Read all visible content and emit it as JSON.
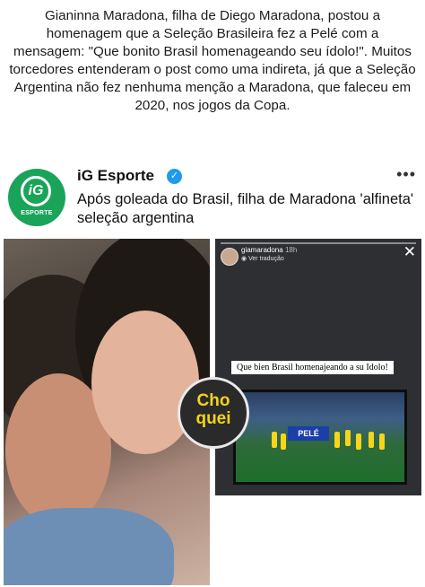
{
  "caption": "Gianinna Maradona, filha de Diego Maradona, postou a homenagem que a Seleção Brasileira fez a Pelé com a mensagem: \"Que bonito Brasil homenageando seu ídolo!\". Muitos torcedores entenderam o post como uma indireta, já que a Seleção Argentina não fez nenhuma menção a Maradona, que faleceu em 2020, nos jogos da Copa.",
  "post": {
    "account_name": "iG Esporte",
    "avatar_brand": "ESPORTE",
    "avatar_mark": "iG",
    "verified_glyph": "✓",
    "more_glyph": "•••",
    "headline": "Após goleada do Brasil, filha de Maradona 'alfineta' seleção argentina"
  },
  "story": {
    "username": "giamaradona",
    "time": "18h",
    "translate_label": "Ver tradução",
    "close_glyph": "✕",
    "caption": "Que bien Brasil homenajeando a su Idolo!",
    "banner_text": "PELÉ"
  },
  "stamp": {
    "line1": "Cho",
    "line2": "quei"
  },
  "colors": {
    "brand_green": "#1aa45a",
    "verified_blue": "#1d9bf0",
    "stamp_yellow": "#f2d21b"
  },
  "icons": [
    "verified-icon",
    "more-options-icon",
    "close-icon",
    "globe-icon"
  ]
}
